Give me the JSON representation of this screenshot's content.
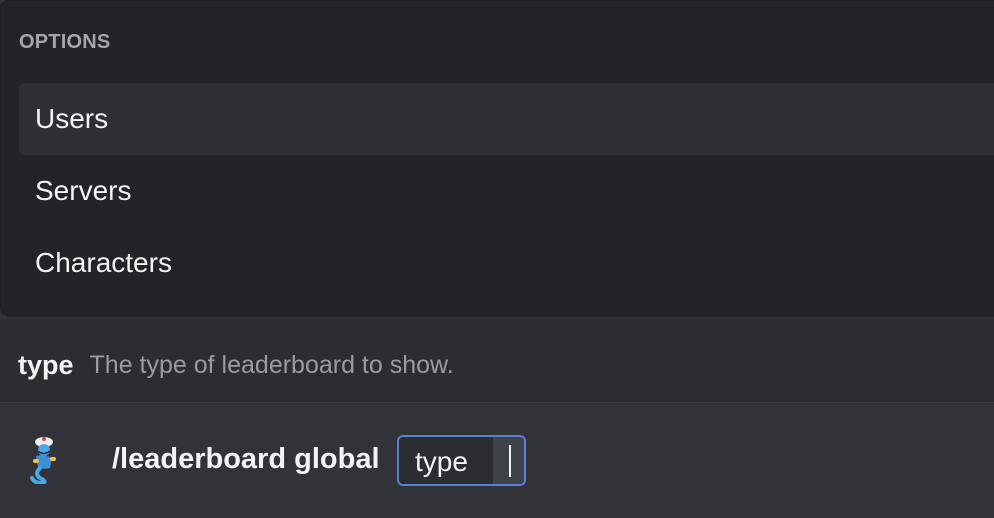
{
  "options_popup": {
    "header": "OPTIONS",
    "items": [
      {
        "label": "Users",
        "selected": true
      },
      {
        "label": "Servers",
        "selected": false
      },
      {
        "label": "Characters",
        "selected": false
      }
    ]
  },
  "param_hint": {
    "name": "type",
    "description": "The type of leaderboard to show."
  },
  "command_bar": {
    "avatar_icon": "genie-bot-icon",
    "command": "/leaderboard global",
    "param_chip_label": "type"
  },
  "colors": {
    "popup_bg": "#232428",
    "selected_item_bg": "#2f3036",
    "chip_border": "#5a7fd6",
    "app_bg": "#313338"
  }
}
